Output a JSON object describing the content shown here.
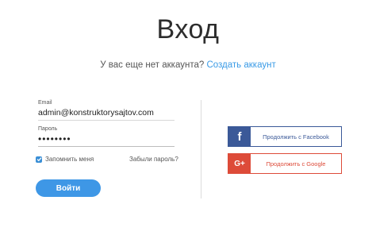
{
  "page": {
    "title": "Вход",
    "no_account_text": "У вас еще нет аккаунта?",
    "create_account_link": "Создать аккаунт"
  },
  "form": {
    "email_label": "Email",
    "email_value": "admin@konstruktorysajtov.com",
    "password_label": "Пароль",
    "password_value": "••••••••",
    "remember_label": "Запомнить меня",
    "remember_checked": true,
    "forgot_link": "Забыли пароль?",
    "login_button": "Войти"
  },
  "social": {
    "facebook_icon": "f",
    "facebook_label": "Продолжить с Facebook",
    "google_icon": "G+",
    "google_label": "Продолжить с Google"
  },
  "colors": {
    "accent": "#3e97e6",
    "facebook": "#3b5998",
    "google": "#dd4b39"
  }
}
